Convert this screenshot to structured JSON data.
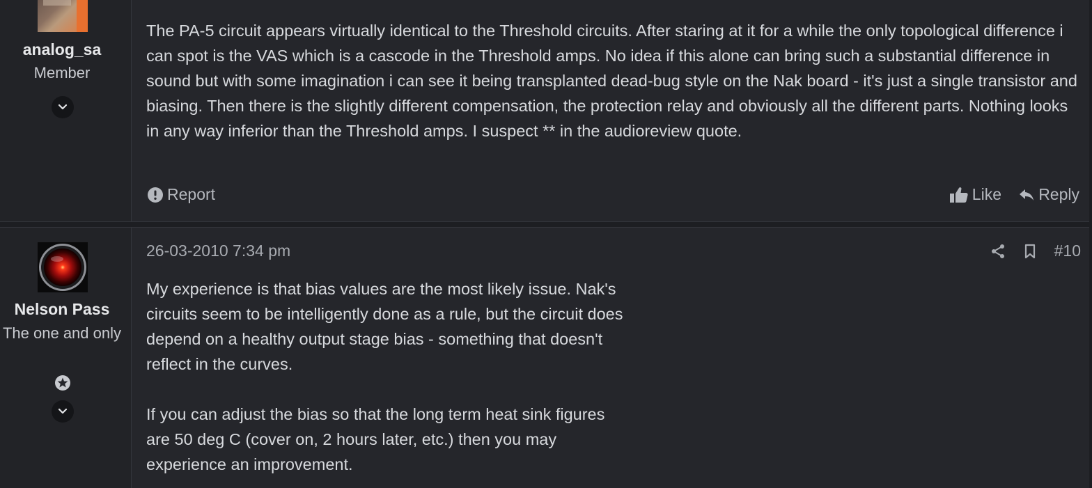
{
  "posts": [
    {
      "username": "analog_sa",
      "user_title": "Member",
      "message": "The PA-5 circuit appears virtually identical to the Threshold circuits. After staring at it for a while the only topological difference i can spot is the VAS which is a cascode in the Threshold amps. No idea if this alone can bring such a substantial difference in sound but with some imagination i can see it being transplanted dead-bug style on the Nak board - it's just a single transistor and biasing. Then there is the slightly different compensation, the protection relay and obviously all the different parts. Nothing looks in any way inferior than the Threshold amps. I suspect ** in the audioreview quote.",
      "report_label": "Report",
      "like_label": "Like",
      "reply_label": "Reply"
    },
    {
      "username": "Nelson Pass",
      "user_title": "The one and only",
      "date": "26-03-2010 7:34 pm",
      "post_number": "#10",
      "paragraphs": [
        "My experience is that bias values are the most likely issue. Nak's circuits seem to be intelligently done as a rule, but the circuit does depend on a healthy output stage bias - something that doesn't reflect in the curves.",
        "If you can adjust the bias so that the long term heat sink figures are 50 deg C (cover on, 2 hours later, etc.) then you may experience an improvement."
      ]
    }
  ],
  "icons": {
    "report": "exclamation-circle-icon",
    "like": "thumbs-up-icon",
    "reply": "reply-arrow-icon",
    "share": "share-icon",
    "bookmark": "bookmark-icon",
    "expand": "chevron-down-icon",
    "badge": "star-badge-icon"
  },
  "colors": {
    "background": "#1d1e22",
    "post_bg": "#25262b",
    "sidebar_bg": "#222327",
    "text": "#d7d9dd",
    "muted": "#a8abb1"
  }
}
